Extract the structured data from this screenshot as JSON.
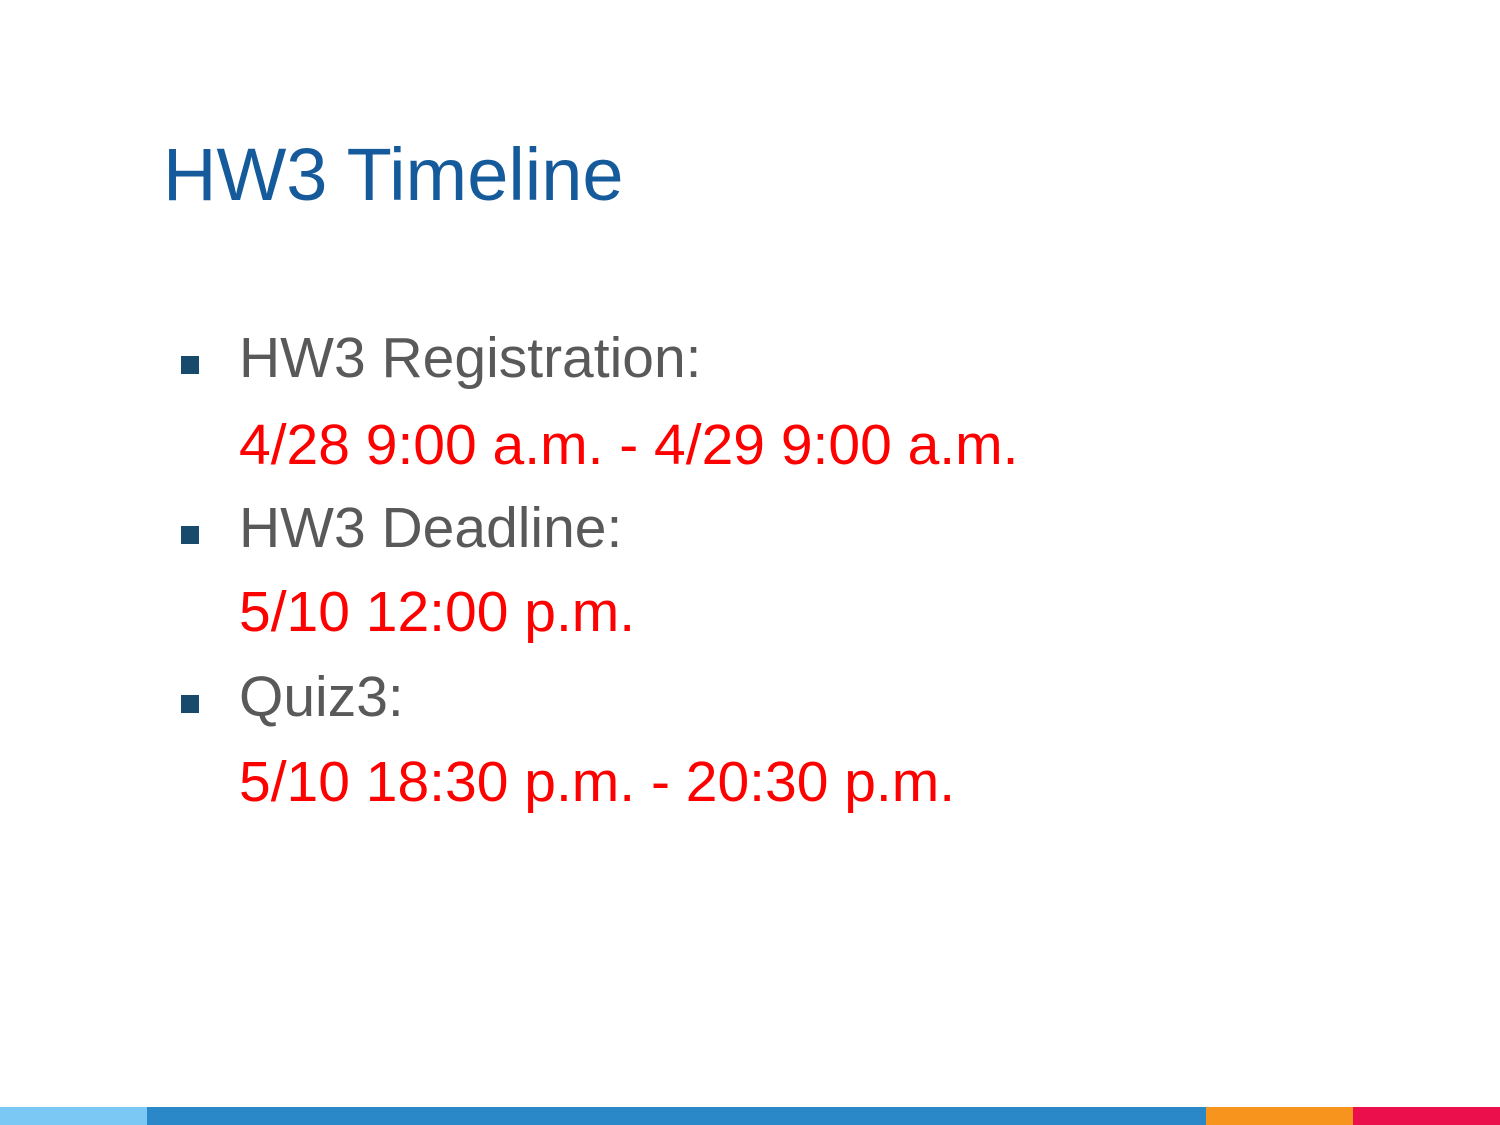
{
  "slide": {
    "title": "HW3 Timeline",
    "items": [
      {
        "label": "HW3 Registration:",
        "value": "4/28 9:00 a.m. - 4/29 9:00 a.m."
      },
      {
        "label": "HW3 Deadline:",
        "value": "5/10 12:00 p.m."
      },
      {
        "label": "Quiz3:",
        "value": "5/10 18:30 p.m. - 20:30 p.m."
      }
    ]
  },
  "colors": {
    "title": "#155a9a",
    "label": "#595959",
    "value": "#ff0000",
    "bullet": "#174a6b",
    "footer": [
      "#7cc8f4",
      "#2a87c8",
      "#f7941d",
      "#eb0f4b"
    ]
  }
}
